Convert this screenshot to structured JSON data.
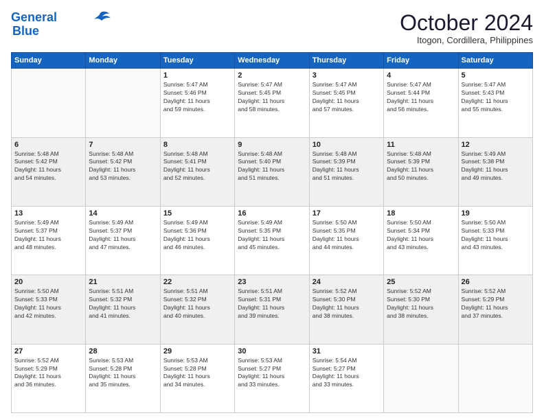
{
  "header": {
    "logo_line1": "General",
    "logo_line2": "Blue",
    "month": "October 2024",
    "location": "Itogon, Cordillera, Philippines"
  },
  "weekdays": [
    "Sunday",
    "Monday",
    "Tuesday",
    "Wednesday",
    "Thursday",
    "Friday",
    "Saturday"
  ],
  "weeks": [
    [
      {
        "day": "",
        "info": ""
      },
      {
        "day": "",
        "info": ""
      },
      {
        "day": "1",
        "info": "Sunrise: 5:47 AM\nSunset: 5:46 PM\nDaylight: 11 hours\nand 59 minutes."
      },
      {
        "day": "2",
        "info": "Sunrise: 5:47 AM\nSunset: 5:45 PM\nDaylight: 11 hours\nand 58 minutes."
      },
      {
        "day": "3",
        "info": "Sunrise: 5:47 AM\nSunset: 5:45 PM\nDaylight: 11 hours\nand 57 minutes."
      },
      {
        "day": "4",
        "info": "Sunrise: 5:47 AM\nSunset: 5:44 PM\nDaylight: 11 hours\nand 56 minutes."
      },
      {
        "day": "5",
        "info": "Sunrise: 5:47 AM\nSunset: 5:43 PM\nDaylight: 11 hours\nand 55 minutes."
      }
    ],
    [
      {
        "day": "6",
        "info": "Sunrise: 5:48 AM\nSunset: 5:42 PM\nDaylight: 11 hours\nand 54 minutes."
      },
      {
        "day": "7",
        "info": "Sunrise: 5:48 AM\nSunset: 5:42 PM\nDaylight: 11 hours\nand 53 minutes."
      },
      {
        "day": "8",
        "info": "Sunrise: 5:48 AM\nSunset: 5:41 PM\nDaylight: 11 hours\nand 52 minutes."
      },
      {
        "day": "9",
        "info": "Sunrise: 5:48 AM\nSunset: 5:40 PM\nDaylight: 11 hours\nand 51 minutes."
      },
      {
        "day": "10",
        "info": "Sunrise: 5:48 AM\nSunset: 5:39 PM\nDaylight: 11 hours\nand 51 minutes."
      },
      {
        "day": "11",
        "info": "Sunrise: 5:48 AM\nSunset: 5:39 PM\nDaylight: 11 hours\nand 50 minutes."
      },
      {
        "day": "12",
        "info": "Sunrise: 5:49 AM\nSunset: 5:38 PM\nDaylight: 11 hours\nand 49 minutes."
      }
    ],
    [
      {
        "day": "13",
        "info": "Sunrise: 5:49 AM\nSunset: 5:37 PM\nDaylight: 11 hours\nand 48 minutes."
      },
      {
        "day": "14",
        "info": "Sunrise: 5:49 AM\nSunset: 5:37 PM\nDaylight: 11 hours\nand 47 minutes."
      },
      {
        "day": "15",
        "info": "Sunrise: 5:49 AM\nSunset: 5:36 PM\nDaylight: 11 hours\nand 46 minutes."
      },
      {
        "day": "16",
        "info": "Sunrise: 5:49 AM\nSunset: 5:35 PM\nDaylight: 11 hours\nand 45 minutes."
      },
      {
        "day": "17",
        "info": "Sunrise: 5:50 AM\nSunset: 5:35 PM\nDaylight: 11 hours\nand 44 minutes."
      },
      {
        "day": "18",
        "info": "Sunrise: 5:50 AM\nSunset: 5:34 PM\nDaylight: 11 hours\nand 43 minutes."
      },
      {
        "day": "19",
        "info": "Sunrise: 5:50 AM\nSunset: 5:33 PM\nDaylight: 11 hours\nand 43 minutes."
      }
    ],
    [
      {
        "day": "20",
        "info": "Sunrise: 5:50 AM\nSunset: 5:33 PM\nDaylight: 11 hours\nand 42 minutes."
      },
      {
        "day": "21",
        "info": "Sunrise: 5:51 AM\nSunset: 5:32 PM\nDaylight: 11 hours\nand 41 minutes."
      },
      {
        "day": "22",
        "info": "Sunrise: 5:51 AM\nSunset: 5:32 PM\nDaylight: 11 hours\nand 40 minutes."
      },
      {
        "day": "23",
        "info": "Sunrise: 5:51 AM\nSunset: 5:31 PM\nDaylight: 11 hours\nand 39 minutes."
      },
      {
        "day": "24",
        "info": "Sunrise: 5:52 AM\nSunset: 5:30 PM\nDaylight: 11 hours\nand 38 minutes."
      },
      {
        "day": "25",
        "info": "Sunrise: 5:52 AM\nSunset: 5:30 PM\nDaylight: 11 hours\nand 38 minutes."
      },
      {
        "day": "26",
        "info": "Sunrise: 5:52 AM\nSunset: 5:29 PM\nDaylight: 11 hours\nand 37 minutes."
      }
    ],
    [
      {
        "day": "27",
        "info": "Sunrise: 5:52 AM\nSunset: 5:29 PM\nDaylight: 11 hours\nand 36 minutes."
      },
      {
        "day": "28",
        "info": "Sunrise: 5:53 AM\nSunset: 5:28 PM\nDaylight: 11 hours\nand 35 minutes."
      },
      {
        "day": "29",
        "info": "Sunrise: 5:53 AM\nSunset: 5:28 PM\nDaylight: 11 hours\nand 34 minutes."
      },
      {
        "day": "30",
        "info": "Sunrise: 5:53 AM\nSunset: 5:27 PM\nDaylight: 11 hours\nand 33 minutes."
      },
      {
        "day": "31",
        "info": "Sunrise: 5:54 AM\nSunset: 5:27 PM\nDaylight: 11 hours\nand 33 minutes."
      },
      {
        "day": "",
        "info": ""
      },
      {
        "day": "",
        "info": ""
      }
    ]
  ]
}
